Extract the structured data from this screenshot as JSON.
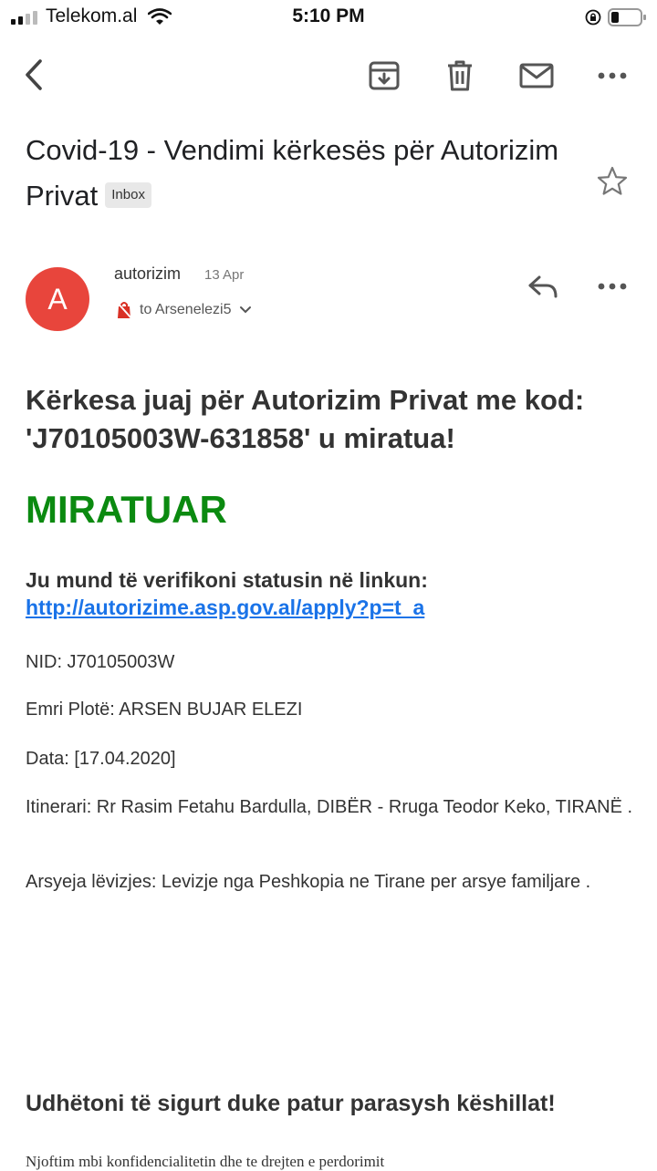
{
  "status_bar": {
    "carrier": "Telekom.al",
    "time": "5:10 PM"
  },
  "toolbar": {
    "icons": [
      "back-arrow-icon",
      "archive-icon",
      "trash-icon",
      "mail-icon",
      "more-icon"
    ]
  },
  "email": {
    "subject": "Covid-19 - Vendimi kërkesës për Autorizim Privat",
    "label": "Inbox",
    "sender_initial": "A",
    "sender": "autorizim",
    "date": "13 Apr",
    "to": "to Arsenelezi5",
    "body": {
      "heading": "Kërkesa juaj për Autorizim Privat me kod: 'J70105003W-631858' u miratua!",
      "status": "MIRATUAR",
      "verify_text": "Ju mund të verifikoni statusin në linkun:",
      "verify_link": "http://autorizime.asp.gov.al/apply?p=t_a",
      "nid": "NID: J70105003W",
      "name": "Emri Plotë: ARSEN BUJAR ELEZI",
      "data": "Data: [17.04.2020]",
      "itinerary": "Itinerari: Rr Rasim Fetahu Bardulla, DIBËR - Rruga Teodor Keko, TIRANË .",
      "reason": "Arsyeja lëvizjes: Levizje nga Peshkopia ne Tirane per arsye familjare .",
      "footer": "Udhëtoni të sigurt duke patur parasysh këshillat!",
      "cut_text": "Njoftim mbi konfidencialitetin dhe te drejten e perdorimit"
    }
  },
  "colors": {
    "avatar": "#e8453c",
    "approved": "#0b8a10",
    "link": "#1a73e8"
  }
}
